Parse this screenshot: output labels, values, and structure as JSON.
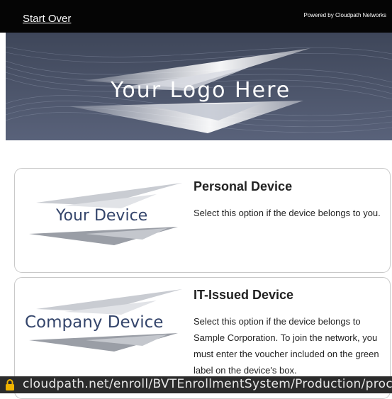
{
  "header": {
    "start_over": "Start Over",
    "powered_by": "Powered by Cloudpath Networks"
  },
  "banner": {
    "logo_text": "Your Logo Here"
  },
  "options": [
    {
      "image_label": "Your Device",
      "title": "Personal Device",
      "description": "Select this option if the device belongs to you."
    },
    {
      "image_label": "Company Device",
      "title": "IT-Issued Device",
      "description": "Select this option if the device belongs to Sample Corporation. To join the network, you must enter the voucher included on the green label on the device's box."
    }
  ],
  "status_bar": {
    "url": "cloudpath.net/enroll/BVTEnrollmentSystem/Production/proce"
  },
  "colors": {
    "header_bg": "#050505",
    "banner_bg": "#4a5366",
    "card_label": "#34456b",
    "status_bar_bg": "#2b2b2b",
    "lock_icon": "#f0b400"
  }
}
